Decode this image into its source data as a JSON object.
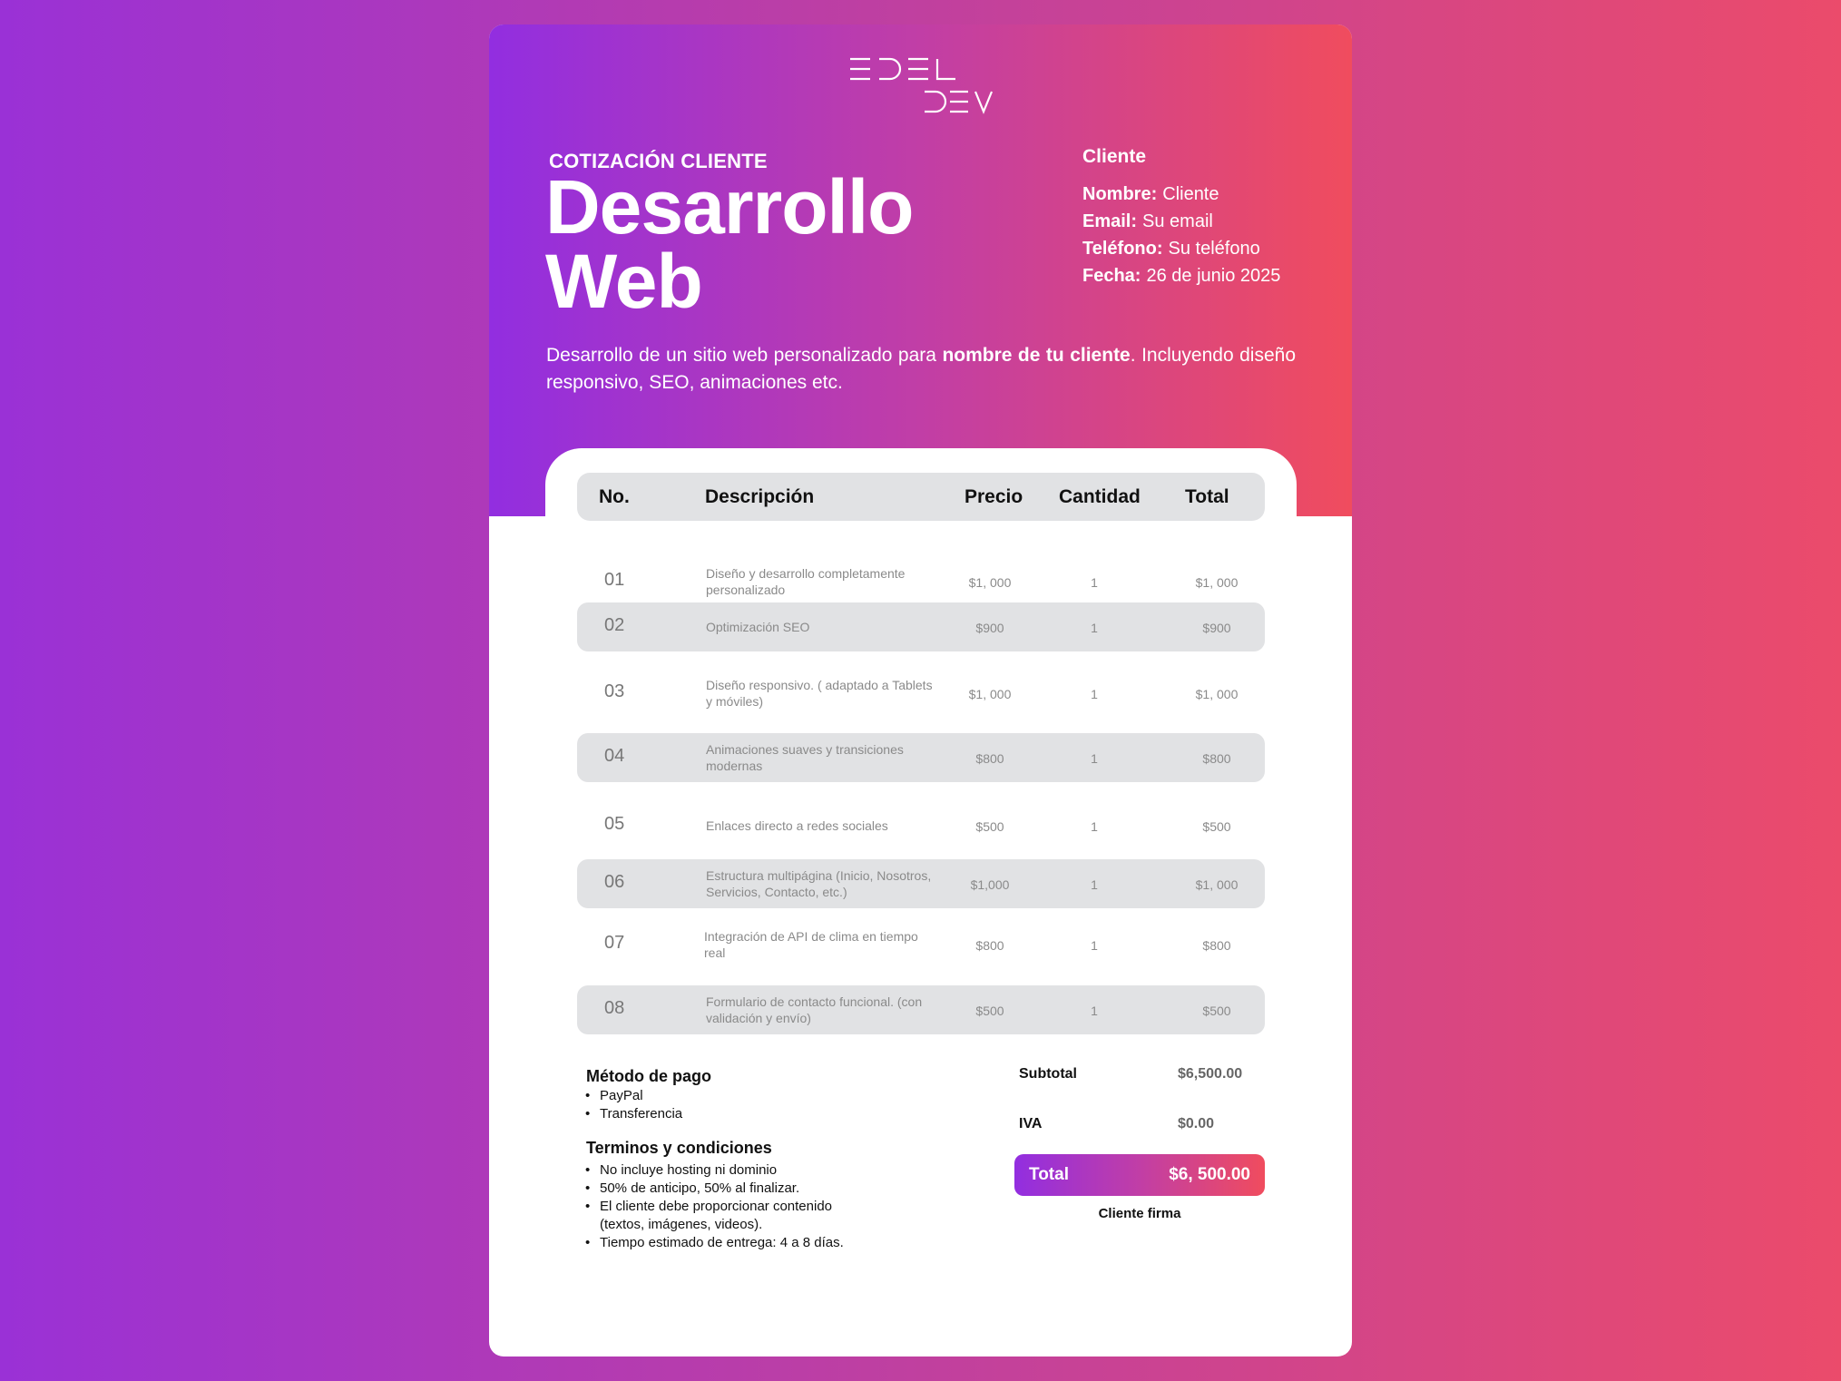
{
  "brand": {
    "logo_alt": "EDEL DEV logo"
  },
  "header": {
    "eyebrow": "COTIZACIÓN CLIENTE",
    "title_line1": "Desarrollo",
    "title_line2": "Web"
  },
  "client": {
    "heading": "Cliente",
    "name_label": "Nombre:",
    "name_value": "Cliente",
    "email_label": "Email:",
    "email_value": "Su email",
    "phone_label": "Teléfono:",
    "phone_value": "Su teléfono",
    "date_label": "Fecha:",
    "date_value": "26 de junio 2025"
  },
  "intro": {
    "part1": "Desarrollo de un sitio web personalizado para ",
    "bold": "nombre de tu cliente",
    "part2": ". Incluyendo diseño responsivo, SEO, animaciones etc."
  },
  "table": {
    "headers": {
      "no": "No.",
      "desc": "Descripción",
      "price": "Precio",
      "qty": "Cantidad",
      "total": "Total"
    },
    "rows": [
      {
        "no": "01",
        "desc": "Diseño y desarrollo completamente personalizado",
        "price": "$1, 000",
        "qty": "1",
        "total": "$1, 000"
      },
      {
        "no": "02",
        "desc": "Optimización SEO",
        "price": "$900",
        "qty": "1",
        "total": "$900"
      },
      {
        "no": "03",
        "desc": "Diseño responsivo. ( adaptado a Tablets y móviles)",
        "price": "$1, 000",
        "qty": "1",
        "total": "$1, 000"
      },
      {
        "no": "04",
        "desc": "Animaciones suaves y transiciones modernas",
        "price": "$800",
        "qty": "1",
        "total": "$800"
      },
      {
        "no": "05",
        "desc": "Enlaces directo a redes sociales",
        "price": "$500",
        "qty": "1",
        "total": "$500"
      },
      {
        "no": "06",
        "desc": "Estructura multipágina (Inicio, Nosotros, Servicios, Contacto, etc.)",
        "price": "$1,000",
        "qty": "1",
        "total": "$1, 000"
      },
      {
        "no": "07",
        "desc": "Integración de API de clima en tiempo real",
        "price": "$800",
        "qty": "1",
        "total": "$800"
      },
      {
        "no": "08",
        "desc": "Formulario de contacto funcional. (con validación y envío)",
        "price": "$500",
        "qty": "1",
        "total": "$500"
      }
    ]
  },
  "payment": {
    "title": "Método de pago",
    "items": [
      "PayPal",
      "Transferencia"
    ]
  },
  "terms": {
    "title": "Terminos y condiciones",
    "items": [
      "No incluye hosting ni dominio",
      "50% de anticipo, 50% al finalizar.",
      "El cliente debe proporcionar contenido (textos, imágenes, videos).",
      "Tiempo estimado de entrega: 4 a 8 días."
    ]
  },
  "summary": {
    "subtotal_label": "Subtotal",
    "subtotal_value": "$6,500.00",
    "iva_label": "IVA",
    "iva_value": "$0.00",
    "total_label": "Total",
    "total_value": "$6, 500.00",
    "signature": "Cliente firma"
  },
  "colors": {
    "gradient_start": "#922ee0",
    "gradient_mid": "#c13ea6",
    "gradient_end": "#f04c5e",
    "row_shade": "#e1e2e4"
  }
}
